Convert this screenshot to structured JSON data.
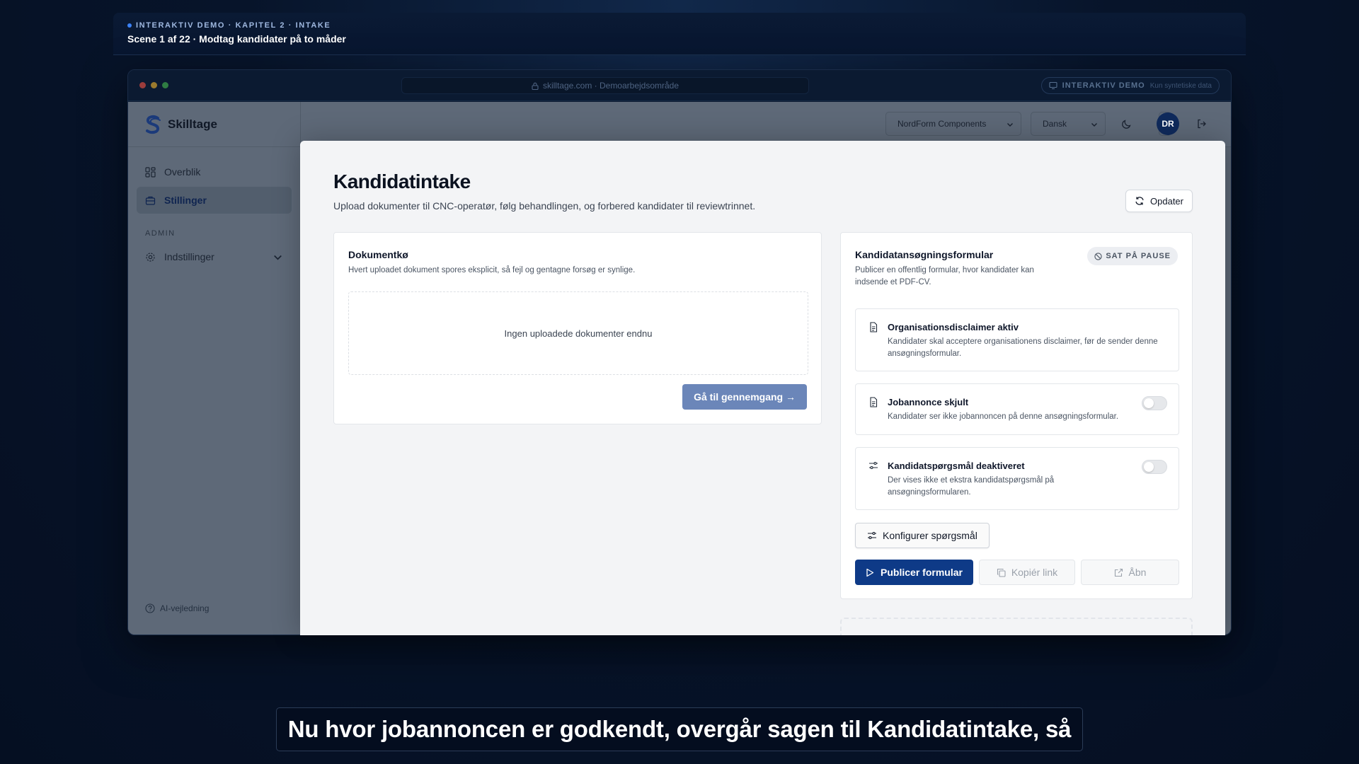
{
  "demo": {
    "kicker": "INTERAKTIV DEMO · KAPITEL 2 · INTAKE",
    "scene": "Scene 1 af 22 · Modtag kandidater på to måder"
  },
  "browser": {
    "url": "skilltage.com · Demoarbejdsområde",
    "demo_pill": "INTERAKTIV DEMO",
    "demo_pill_sub": "Kun syntetiske data"
  },
  "app": {
    "brand": "Skilltage",
    "nav": {
      "overview": "Overblik",
      "jobs": "Stillinger",
      "section_admin": "ADMIN",
      "settings": "Indstillinger",
      "ai_help": "AI-vejledning"
    },
    "topbar": {
      "company": "NordForm Components",
      "language": "Dansk",
      "avatar": "DR"
    }
  },
  "modal": {
    "title": "Kandidatintake",
    "subtitle": "Upload dokumenter til CNC-operatør, følg behandlingen, og forbered kandidater til reviewtrinnet.",
    "refresh": "Opdater",
    "queue": {
      "title": "Dokumentkø",
      "desc": "Hvert uploadet dokument spores eksplicit, så fejl og gentagne forsøg er synlige.",
      "empty": "Ingen uploadede dokumenter endnu",
      "goto_review": "Gå til gennemgang →"
    },
    "form": {
      "title": "Kandidatansøgningsformular",
      "desc": "Publicer en offentlig formular, hvor kandidater kan indsende et PDF-CV.",
      "status": "SAT PÅ PAUSE",
      "settings": [
        {
          "title": "Organisationsdisclaimer aktiv",
          "desc": "Kandidater skal acceptere organisationens disclaimer, før de sender denne ansøgningsformular."
        },
        {
          "title": "Jobannonce skjult",
          "desc": "Kandidater ser ikke jobannoncen på denne ansøgningsformular."
        },
        {
          "title": "Kandidatspørgsmål deaktiveret",
          "desc": "Der vises ikke et ekstra kandidatspørgsmål på ansøgningsformularen."
        }
      ],
      "configure": "Konfigurer spørgsmål",
      "publish": "Publicer formular",
      "copy_link": "Kopiér link",
      "open": "Åbn"
    }
  },
  "caption": "Nu hvor jobannoncen er godkendt, overgår sagen til Kandidatintake, så",
  "colors": {
    "primary": "#0e3a87",
    "primary_soft": "#6b86b9",
    "background": "#050f22"
  }
}
